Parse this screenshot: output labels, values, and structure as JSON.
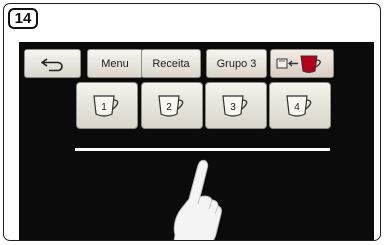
{
  "step": {
    "number": "14"
  },
  "toolbar": {
    "back_icon": "back-arrow-icon",
    "menu_label": "Menu",
    "recipe_label": "Receita",
    "group_label": "Grupo 3",
    "swap_icon": "cup-swap-icon"
  },
  "cup_buttons": [
    {
      "label": "1",
      "icon": "cup-icon"
    },
    {
      "label": "2",
      "icon": "cup-icon"
    },
    {
      "label": "3",
      "icon": "cup-icon"
    },
    {
      "label": "4",
      "icon": "cup-icon"
    }
  ],
  "colors": {
    "screen_background": "#0b0b0b",
    "button_face": "#e8e4da",
    "accent_red": "#b3001b",
    "divider": "#ffffff"
  },
  "gesture": {
    "icon": "pointing-hand-icon"
  }
}
